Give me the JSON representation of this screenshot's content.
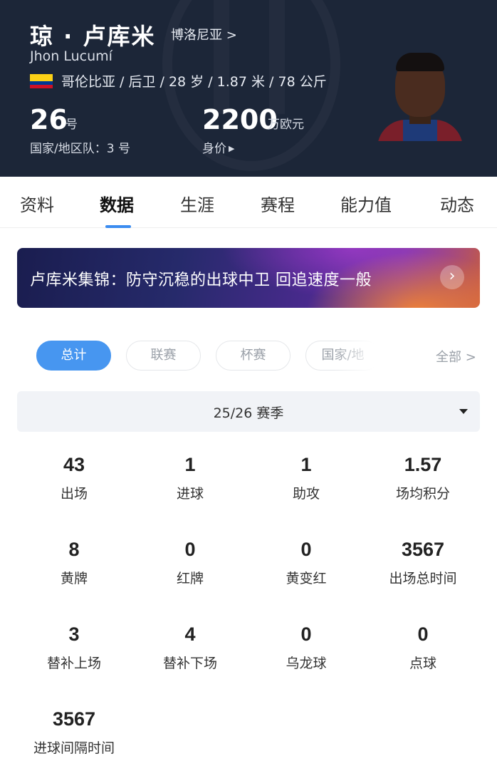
{
  "player": {
    "name_cn": "琼 · 卢库米",
    "club": "博洛尼亚 >",
    "name_en": "Jhon Lucumí",
    "flag_icon": "colombia-flag-icon",
    "bio": "哥伦比亚 / 后卫 / 28 岁 / 1.87 米 / 78 公斤",
    "number": "26",
    "number_unit": "号",
    "national_team": "国家/地区队：3 号",
    "market_value": "2200",
    "market_value_unit": "万欧元",
    "market_value_label": "身价"
  },
  "tabs": [
    "资料",
    "数据",
    "生涯",
    "赛程",
    "能力值",
    "动态"
  ],
  "active_tab": "数据",
  "banner": {
    "text": "卢库米集锦：防守沉稳的出球中卫 回追速度一般"
  },
  "filters": {
    "chips": [
      "总计",
      "联赛",
      "杯赛",
      "国家/地"
    ],
    "active": "总计",
    "all_label": "全部 >"
  },
  "season": {
    "label": "25/26 赛季"
  },
  "stats": [
    {
      "value": "43",
      "label": "出场"
    },
    {
      "value": "1",
      "label": "进球"
    },
    {
      "value": "1",
      "label": "助攻"
    },
    {
      "value": "1.57",
      "label": "场均积分"
    },
    {
      "value": "8",
      "label": "黄牌"
    },
    {
      "value": "0",
      "label": "红牌"
    },
    {
      "value": "0",
      "label": "黄变红"
    },
    {
      "value": "3567",
      "label": "出场总时间"
    },
    {
      "value": "3",
      "label": "替补上场"
    },
    {
      "value": "4",
      "label": "替补下场"
    },
    {
      "value": "0",
      "label": "乌龙球"
    },
    {
      "value": "0",
      "label": "点球"
    },
    {
      "value": "3567",
      "label": "进球间隔时间"
    }
  ],
  "colors": {
    "header_bg": "#1c2638",
    "accent": "#4796f0",
    "tab_indicator": "#3b8cf0"
  }
}
